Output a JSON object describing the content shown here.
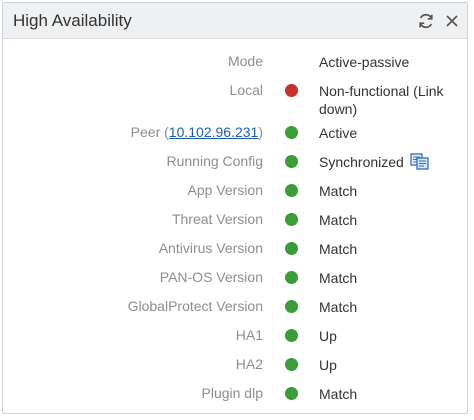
{
  "header": {
    "title": "High Availability",
    "icons": [
      "refresh-icon",
      "close-icon"
    ]
  },
  "colors": {
    "ok": "#3a9d3a",
    "error": "#c9302c"
  },
  "rows": {
    "mode": {
      "label": "Mode",
      "value": "Active-passive"
    },
    "local": {
      "label": "Local",
      "status": "error",
      "value": "Non-functional (Link down)"
    },
    "peer": {
      "label_prefix": "Peer (",
      "ip": "10.102.96.231",
      "label_suffix": ")",
      "status": "ok",
      "value": "Active"
    },
    "running_config": {
      "label": "Running Config",
      "status": "ok",
      "value": "Synchronized",
      "icon": "sync-config-icon"
    },
    "app_version": {
      "label": "App Version",
      "status": "ok",
      "value": "Match"
    },
    "threat_version": {
      "label": "Threat Version",
      "status": "ok",
      "value": "Match"
    },
    "antivirus_version": {
      "label": "Antivirus Version",
      "status": "ok",
      "value": "Match"
    },
    "panos_version": {
      "label": "PAN-OS Version",
      "status": "ok",
      "value": "Match"
    },
    "globalprotect_version": {
      "label": "GlobalProtect Version",
      "status": "ok",
      "value": "Match"
    },
    "ha1": {
      "label": "HA1",
      "status": "ok",
      "value": "Up"
    },
    "ha2": {
      "label": "HA2",
      "status": "ok",
      "value": "Up"
    },
    "plugin_dlp": {
      "label": "Plugin dlp",
      "status": "ok",
      "value": "Match"
    }
  }
}
